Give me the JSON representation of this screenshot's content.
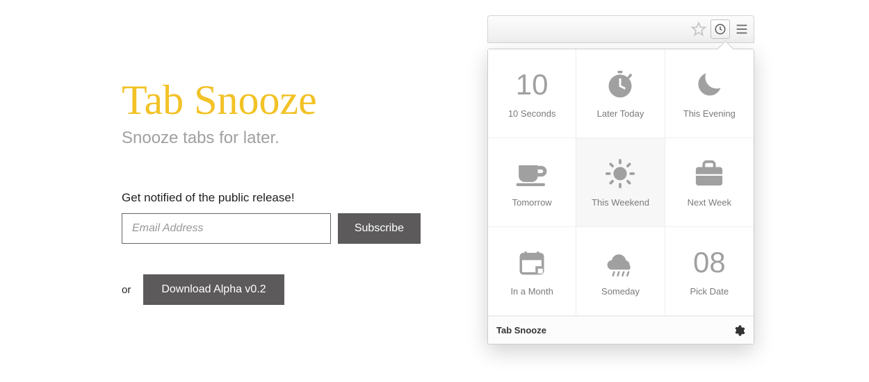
{
  "landing": {
    "title": "Tab Snooze",
    "tagline": "Snooze tabs for later.",
    "notify_label": "Get notified of the public release!",
    "email_placeholder": "Email Address",
    "subscribe_label": "Subscribe",
    "or_label": "or",
    "download_label": "Download Alpha v0.2"
  },
  "popup": {
    "tiles": [
      {
        "label": "10 Seconds",
        "icon": "ten"
      },
      {
        "label": "Later Today",
        "icon": "stopwatch"
      },
      {
        "label": "This Evening",
        "icon": "moon"
      },
      {
        "label": "Tomorrow",
        "icon": "cup"
      },
      {
        "label": "This Weekend",
        "icon": "sun",
        "highlight": true
      },
      {
        "label": "Next Week",
        "icon": "briefcase"
      },
      {
        "label": "In a Month",
        "icon": "calendar"
      },
      {
        "label": "Someday",
        "icon": "cloud"
      },
      {
        "label": "Pick Date",
        "icon": "zero-eight"
      }
    ],
    "footer_title": "Tab Snooze",
    "ten_text": "10",
    "zero_eight_text": "08"
  }
}
